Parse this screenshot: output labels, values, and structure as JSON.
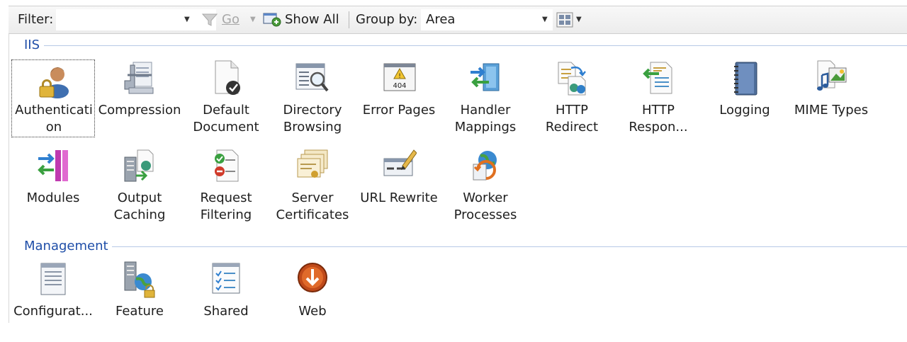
{
  "toolbar": {
    "filter_label": "Filter:",
    "filter_value": "",
    "go_label": "Go",
    "show_all_label": "Show All",
    "group_by_label": "Group by:",
    "group_by_value": "Area"
  },
  "sections": {
    "iis": {
      "title": "IIS",
      "items": [
        {
          "label": "Authenticati on",
          "icon": "authentication-icon",
          "selected": true
        },
        {
          "label": "Compression",
          "icon": "compression-icon"
        },
        {
          "label": "Default Document",
          "icon": "default-document-icon"
        },
        {
          "label": "Directory Browsing",
          "icon": "directory-browsing-icon"
        },
        {
          "label": "Error Pages",
          "icon": "error-pages-icon"
        },
        {
          "label": "Handler Mappings",
          "icon": "handler-mappings-icon"
        },
        {
          "label": "HTTP Redirect",
          "icon": "http-redirect-icon"
        },
        {
          "label": "HTTP Respon...",
          "icon": "http-response-headers-icon"
        },
        {
          "label": "Logging",
          "icon": "logging-icon"
        },
        {
          "label": "MIME Types",
          "icon": "mime-types-icon"
        },
        {
          "label": "Modules",
          "icon": "modules-icon"
        },
        {
          "label": "Output Caching",
          "icon": "output-caching-icon"
        },
        {
          "label": "Request Filtering",
          "icon": "request-filtering-icon"
        },
        {
          "label": "Server Certificates",
          "icon": "server-certificates-icon"
        },
        {
          "label": "URL Rewrite",
          "icon": "url-rewrite-icon"
        },
        {
          "label": "Worker Processes",
          "icon": "worker-processes-icon"
        }
      ]
    },
    "management": {
      "title": "Management",
      "items": [
        {
          "label": "Configurat...",
          "icon": "configuration-editor-icon"
        },
        {
          "label": "Feature",
          "icon": "feature-delegation-icon"
        },
        {
          "label": "Shared",
          "icon": "shared-configuration-icon"
        },
        {
          "label": "Web",
          "icon": "web-platform-installer-icon"
        }
      ]
    }
  }
}
